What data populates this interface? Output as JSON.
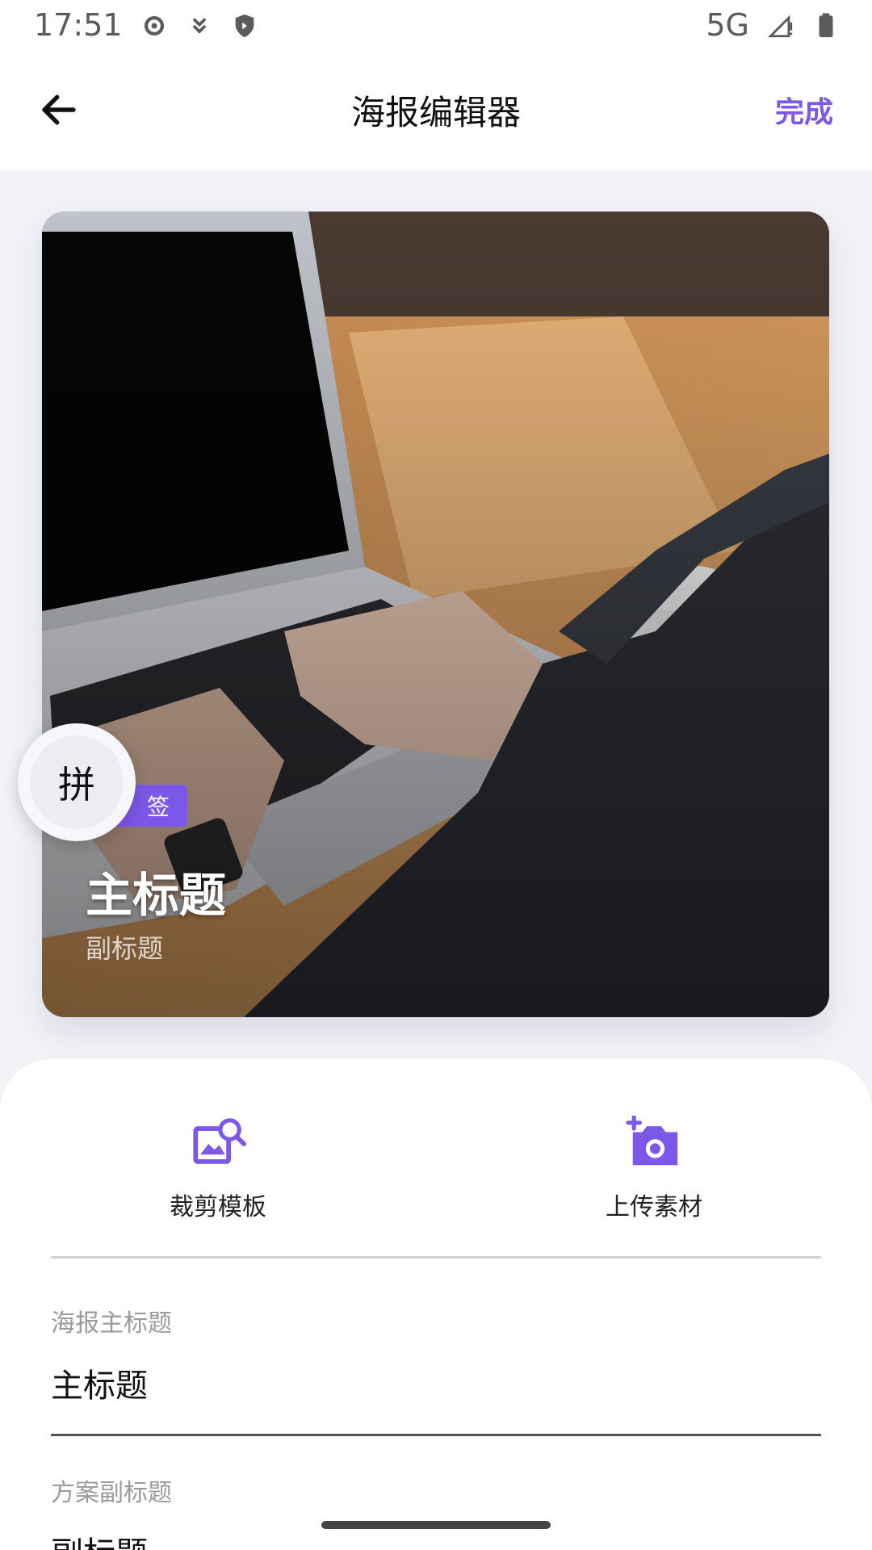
{
  "status": {
    "time": "17:51",
    "network": "5G",
    "icons": [
      "settings-icon",
      "download-icon",
      "shield-icon",
      "signal-icon",
      "battery-icon"
    ]
  },
  "appbar": {
    "title": "海报编辑器",
    "done": "完成"
  },
  "poster": {
    "tag": "签",
    "main_title": "主标题",
    "subtitle": "副标题",
    "pin_label": "拼"
  },
  "actions": [
    {
      "label": "裁剪模板",
      "icon": "image-search-icon"
    },
    {
      "label": "上传素材",
      "icon": "camera-add-icon"
    }
  ],
  "form": {
    "main_title_label": "海报主标题",
    "main_title_value": "主标题",
    "subtitle_label": "方案副标题",
    "subtitle_value": "副标题"
  },
  "colors": {
    "accent": "#7d58e8",
    "background": "#f2f2f7"
  }
}
